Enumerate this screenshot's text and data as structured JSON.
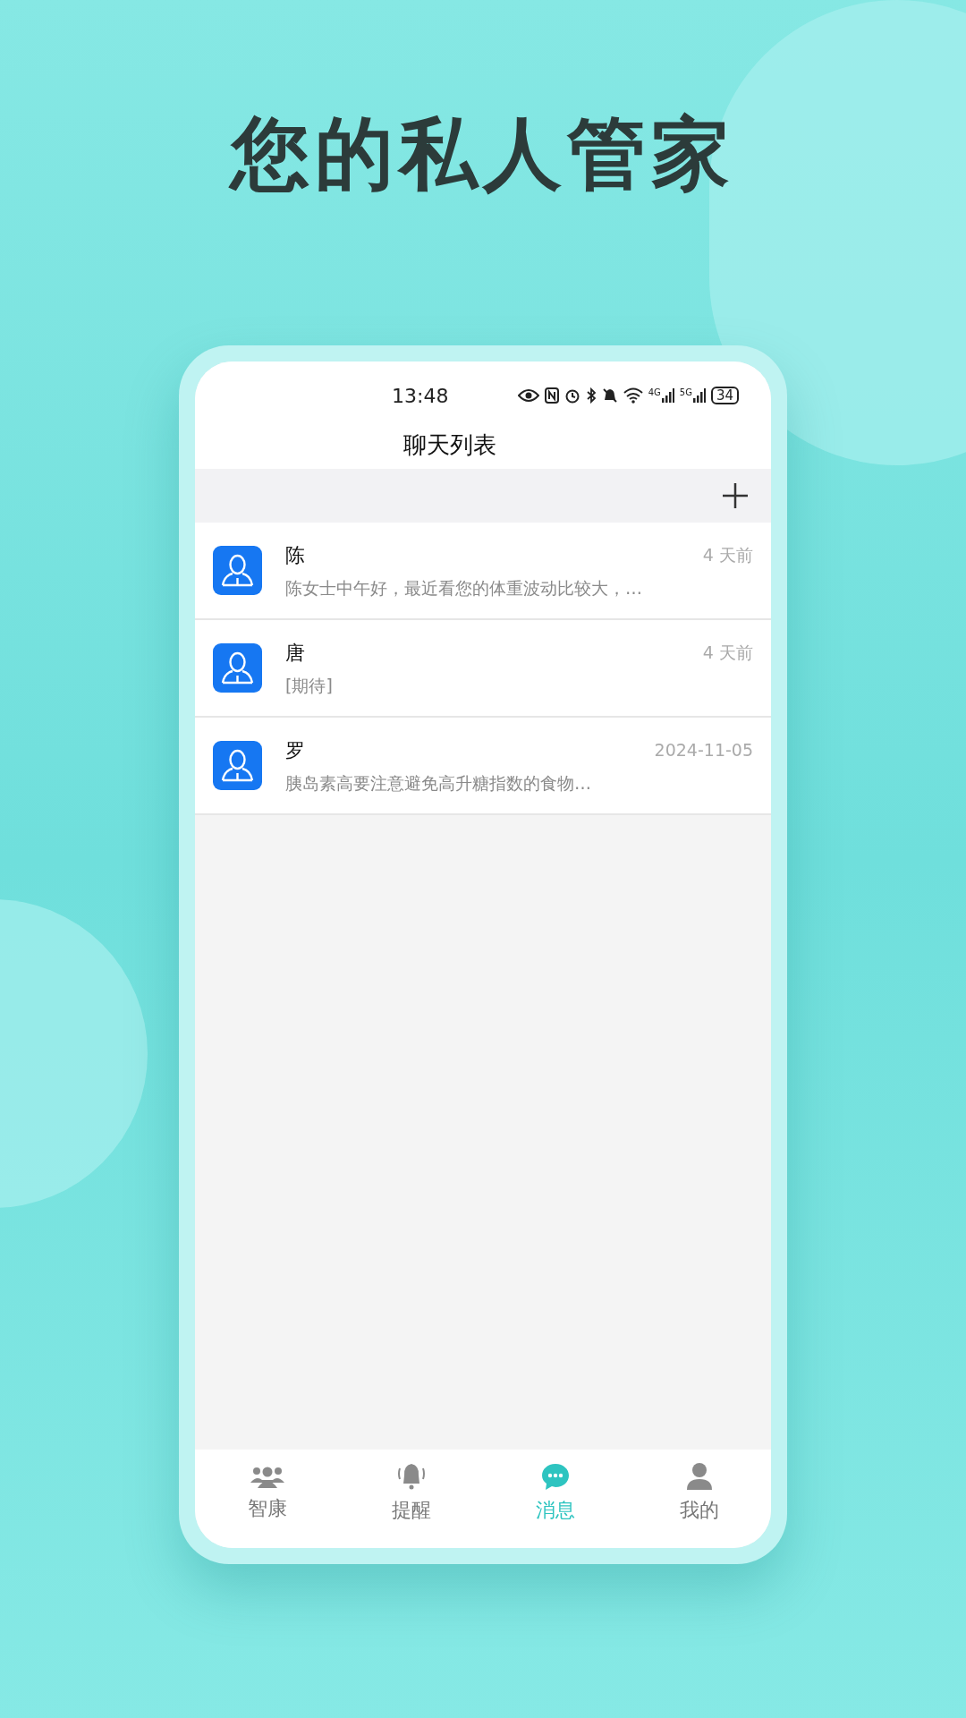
{
  "headline": "您的私人管家",
  "status_bar": {
    "time": "13:48",
    "network_labels": [
      "4G",
      "5G"
    ],
    "battery": "34"
  },
  "header": {
    "title": "聊天列表"
  },
  "chats": [
    {
      "name": "陈",
      "preview": "陈女士中午好，最近看您的体重波动比较大，…",
      "time": "4 天前"
    },
    {
      "name": "唐",
      "preview": "[期待]",
      "time": "4 天前"
    },
    {
      "name": "罗",
      "preview": "胰岛素高要注意避免高升糖指数的食物…",
      "time": "2024-11-05"
    }
  ],
  "tab_bar": [
    {
      "kind": "group",
      "label": "智康",
      "selected": false
    },
    {
      "kind": "bell",
      "label": "提醒",
      "selected": false
    },
    {
      "kind": "chat",
      "label": "消息",
      "selected": true
    },
    {
      "kind": "person",
      "label": "我的",
      "selected": false
    }
  ]
}
